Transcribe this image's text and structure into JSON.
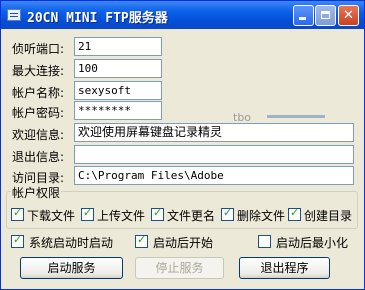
{
  "window": {
    "title": "20CN MINI FTP服务器"
  },
  "fields": [
    {
      "label": "侦听端口:",
      "value": "21"
    },
    {
      "label": "最大连接:",
      "value": "100"
    },
    {
      "label": "帐户名称:",
      "value": "sexysoft"
    },
    {
      "label": "帐户密码:",
      "value": "********"
    },
    {
      "label": "欢迎信息:",
      "value": "欢迎使用屏幕键盘记录精灵"
    },
    {
      "label": "退出信息:",
      "value": ""
    },
    {
      "label": "访问目录:",
      "value": "C:\\Program Files\\Adobe"
    }
  ],
  "background_hint": {
    "label": "tbo"
  },
  "permissions": {
    "title": "帐户权限",
    "items": [
      {
        "label": "下载文件",
        "checked": true
      },
      {
        "label": "上传文件",
        "checked": true
      },
      {
        "label": "文件更名",
        "checked": true
      },
      {
        "label": "删除文件",
        "checked": true
      },
      {
        "label": "创建目录",
        "checked": true
      }
    ]
  },
  "options": [
    {
      "label": "系统启动时启动",
      "checked": true
    },
    {
      "label": "启动后开始",
      "checked": true
    },
    {
      "label": "启动后最小化",
      "checked": false
    }
  ],
  "buttons": {
    "start": "启动服务",
    "stop": "停止服务",
    "exit": "退出程序"
  },
  "colors": {
    "titlebar": "#0a5fe8",
    "check": "#21a121",
    "dialog_bg": "#ece9d8"
  }
}
